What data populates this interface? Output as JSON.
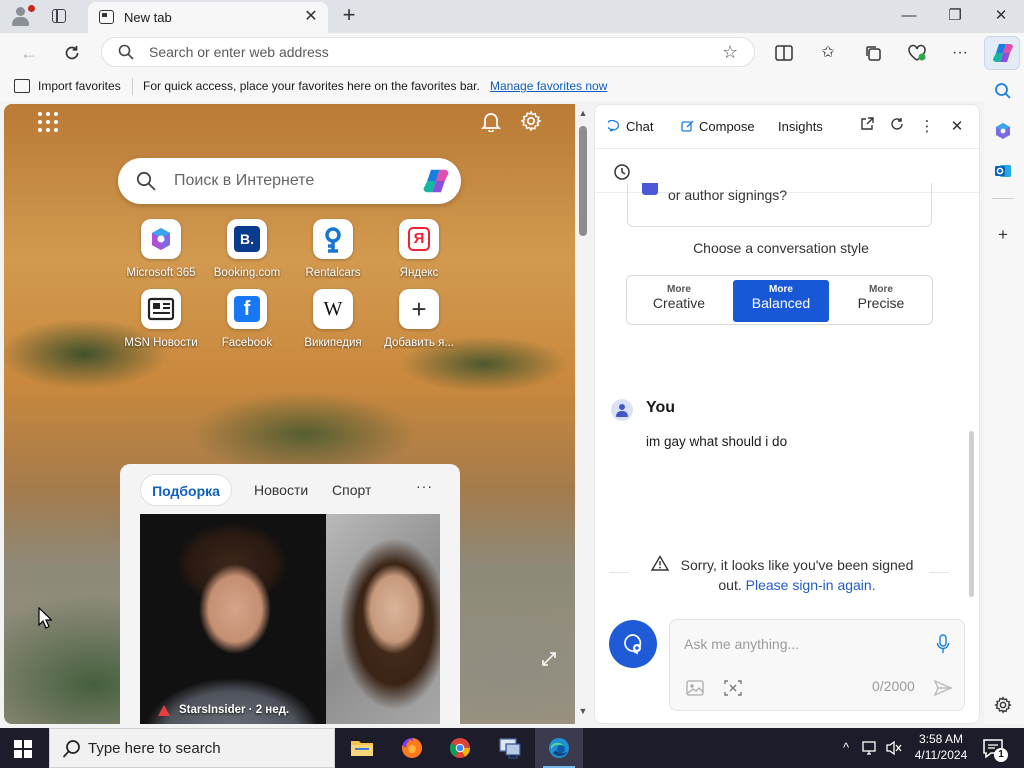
{
  "browser": {
    "tab_title": "New tab",
    "address_placeholder": "Search or enter web address",
    "favorites_bar": {
      "import_label": "Import favorites",
      "hint": "For quick access, place your favorites here on the favorites bar.",
      "manage_link": "Manage favorites now"
    }
  },
  "new_tab_page": {
    "search_placeholder": "Поиск в Интернете",
    "tiles": [
      {
        "label": "Microsoft 365",
        "icon": "microsoft-365-icon"
      },
      {
        "label": "Booking.com",
        "icon": "booking-icon",
        "glyph": "B."
      },
      {
        "label": "Rentalcars",
        "icon": "rentalcars-icon"
      },
      {
        "label": "Яндекс",
        "icon": "yandex-icon",
        "glyph": "Я"
      },
      {
        "label": "MSN Новости",
        "icon": "msn-news-icon"
      },
      {
        "label": "Facebook",
        "icon": "facebook-icon",
        "glyph": "f"
      },
      {
        "label": "Википедия",
        "icon": "wikipedia-icon",
        "glyph": "W"
      },
      {
        "label": "Добавить я...",
        "icon": "plus-icon",
        "glyph": "+"
      }
    ],
    "feed": {
      "tabs": [
        "Подборка",
        "Новости",
        "Спорт"
      ],
      "more": "···",
      "card_source": "StarsInsider · 2 нед."
    }
  },
  "copilot_panel": {
    "tabs": {
      "chat": "Chat",
      "compose": "Compose",
      "insights": "Insights"
    },
    "previous_prompt_fragment": "or author signings?",
    "style_title": "Choose a conversation style",
    "styles": [
      {
        "small": "More",
        "big": "Creative",
        "active": false
      },
      {
        "small": "More",
        "big": "Balanced",
        "active": true
      },
      {
        "small": "More",
        "big": "Precise",
        "active": false
      }
    ],
    "user_name": "You",
    "user_message": "im gay what should i do",
    "warning": {
      "line1": "Sorry, it looks like you've been signed",
      "line2_prefix": "out. ",
      "link": "Please sign-in again."
    },
    "input_placeholder": "Ask me anything...",
    "char_count": "0/2000"
  },
  "taskbar": {
    "search_placeholder": "Type here to search",
    "time": "3:58 AM",
    "date": "4/11/2024",
    "notification_count": "1"
  },
  "colors": {
    "accent": "#1858d6",
    "link": "#0f5fbf"
  }
}
